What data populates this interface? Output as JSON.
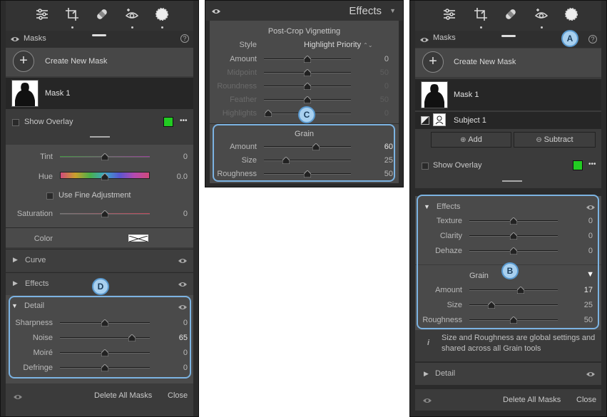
{
  "left_panel": {
    "masks_title": "Masks",
    "help_glyph": "?",
    "create_new_mask": "Create New Mask",
    "mask1": "Mask 1",
    "show_overlay": "Show Overlay",
    "overlay_color": "#22cc22",
    "more": "•••",
    "tint": {
      "label": "Tint",
      "value": "0",
      "pos": 0.5
    },
    "hue": {
      "label": "Hue",
      "value": "0.0",
      "pos": 0.5
    },
    "use_fine_adjustment": "Use Fine Adjustment",
    "saturation": {
      "label": "Saturation",
      "value": "0",
      "pos": 0.5
    },
    "color_label": "Color",
    "curve": "Curve",
    "effects": "Effects",
    "detail": "Detail",
    "sliders": [
      {
        "label": "Sharpness",
        "value": "0",
        "pos": 0.5
      },
      {
        "label": "Noise",
        "value": "65",
        "pos": 0.8,
        "hi": true
      },
      {
        "label": "Moiré",
        "value": "0",
        "pos": 0.5
      },
      {
        "label": "Defringe",
        "value": "0",
        "pos": 0.5
      }
    ],
    "delete_all_masks": "Delete All Masks",
    "close": "Close",
    "callout": "D"
  },
  "middle_panel": {
    "title": "Effects",
    "vignette_title": "Post-Crop Vignetting",
    "style_label": "Style",
    "style_value": "Highlight Priority",
    "vignette_sliders": [
      {
        "label": "Amount",
        "value": "0",
        "pos": 0.5
      },
      {
        "label": "Midpoint",
        "value": "50",
        "pos": 0.5,
        "dim": true
      },
      {
        "label": "Roundness",
        "value": "0",
        "pos": 0.5,
        "dim": true
      },
      {
        "label": "Feather",
        "value": "50",
        "pos": 0.5,
        "dim": true
      },
      {
        "label": "Highlights",
        "value": "0",
        "pos": 0.05,
        "dim": true
      }
    ],
    "grain_title": "Grain",
    "grain_sliders": [
      {
        "label": "Amount",
        "value": "60",
        "pos": 0.6,
        "hi": true
      },
      {
        "label": "Size",
        "value": "25",
        "pos": 0.25
      },
      {
        "label": "Roughness",
        "value": "50",
        "pos": 0.5
      }
    ],
    "callout": "C"
  },
  "right_panel": {
    "masks_title": "Masks",
    "help_glyph": "?",
    "create_new_mask": "Create New Mask",
    "mask1": "Mask 1",
    "subject1": "Subject 1",
    "add": "Add",
    "subtract": "Subtract",
    "show_overlay": "Show Overlay",
    "overlay_color": "#22cc22",
    "more": "•••",
    "effects": "Effects",
    "effects_sliders": [
      {
        "label": "Texture",
        "value": "0",
        "pos": 0.5
      },
      {
        "label": "Clarity",
        "value": "0",
        "pos": 0.5
      },
      {
        "label": "Dehaze",
        "value": "0",
        "pos": 0.5
      }
    ],
    "grain_title": "Grain",
    "grain_sliders": [
      {
        "label": "Amount",
        "value": "17",
        "pos": 0.58,
        "hi": true
      },
      {
        "label": "Size",
        "value": "25",
        "pos": 0.25
      },
      {
        "label": "Roughness",
        "value": "50",
        "pos": 0.5
      }
    ],
    "info": "Size and Roughness are global settings and shared across all Grain tools",
    "detail": "Detail",
    "delete_all_masks": "Delete All Masks",
    "close": "Close",
    "callout_a": "A",
    "callout_b": "B"
  }
}
